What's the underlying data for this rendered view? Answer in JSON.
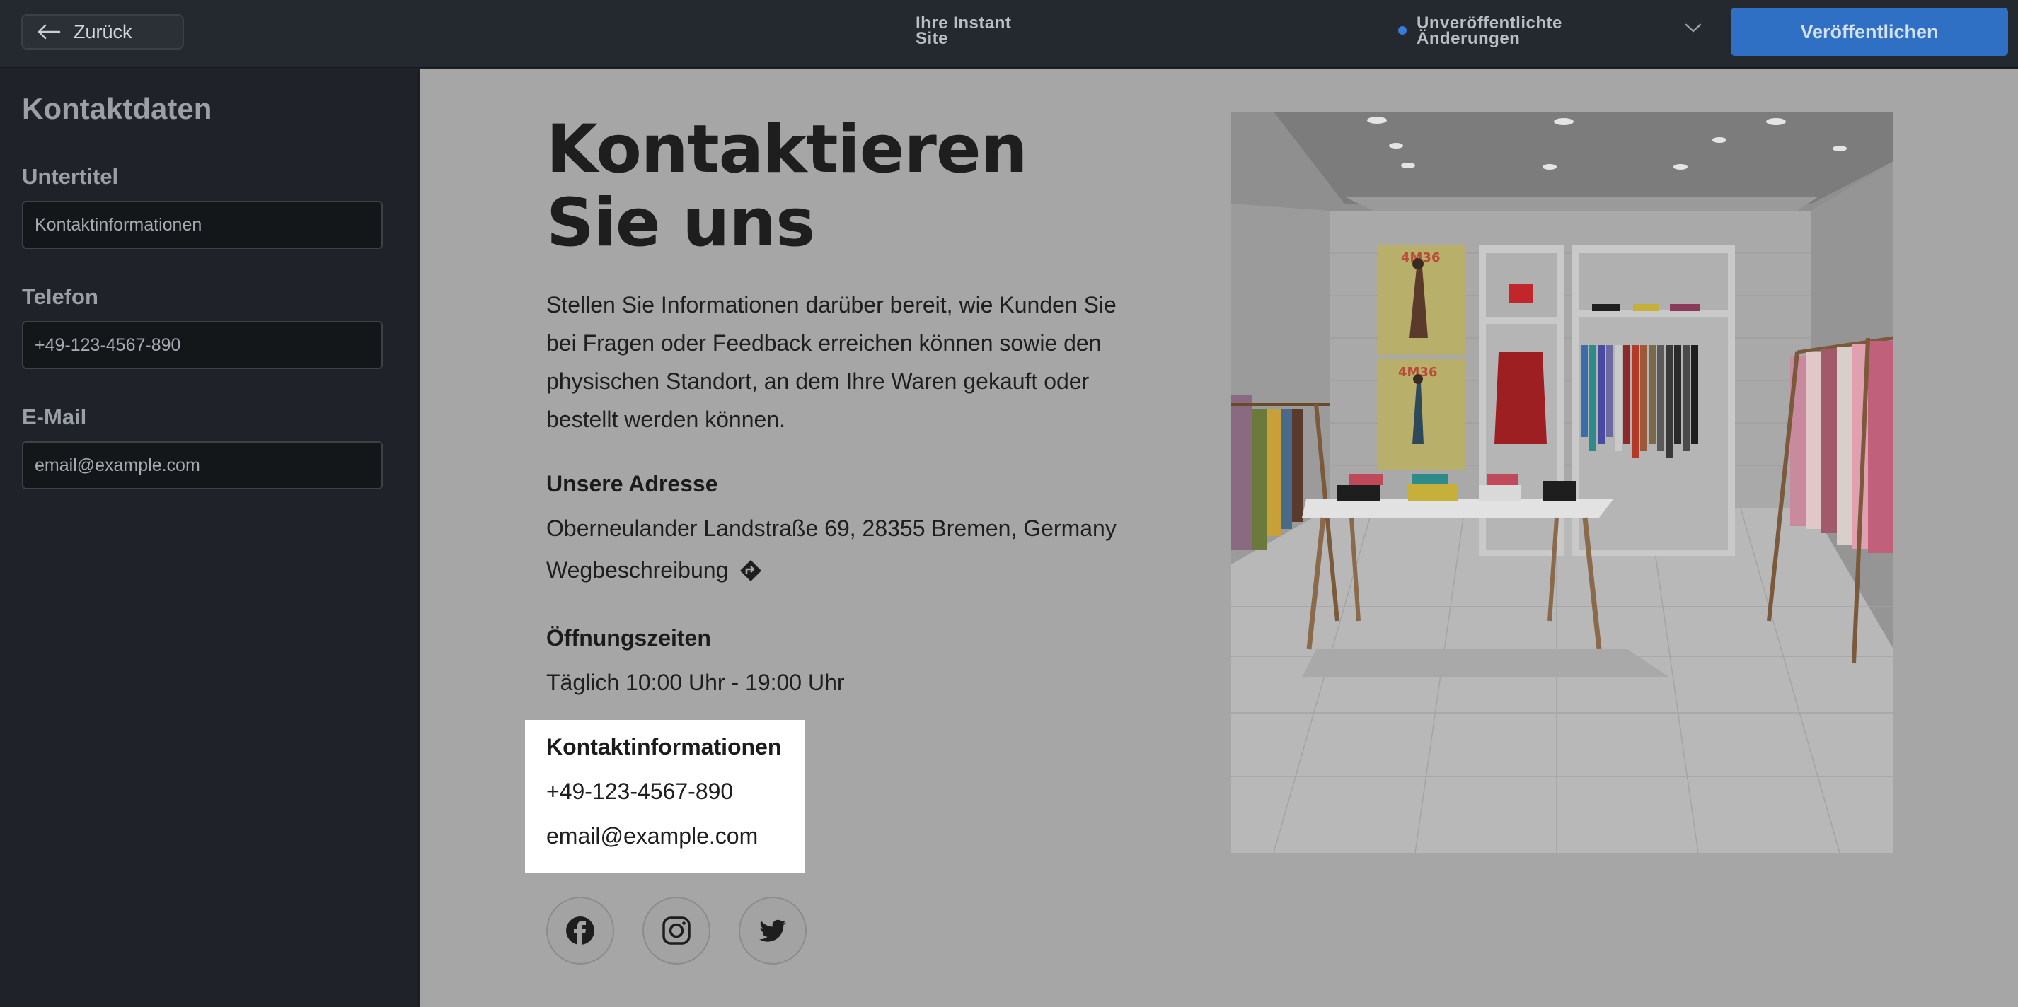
{
  "topbar": {
    "back_label": "Zurück",
    "site_title": "Ihre Instant Site",
    "status_text": "Unveröffentlichte Änderungen",
    "publish_label": "Veröffentlichen"
  },
  "sidebar": {
    "title": "Kontaktdaten",
    "fields": [
      {
        "label": "Untertitel",
        "value": "Kontaktinformationen"
      },
      {
        "label": "Telefon",
        "value": "+49-123-4567-890"
      },
      {
        "label": "E-Mail",
        "value": "email@example.com"
      }
    ]
  },
  "page": {
    "heading": "Kontaktieren Sie uns",
    "description": "Stellen Sie Informationen darüber bereit, wie Kunden Sie bei Fragen oder Feedback erreichen können sowie den physischen Standort, an dem Ihre Waren gekauft oder bestellt werden können.",
    "address_label": "Unsere Adresse",
    "address": "Oberneulander Landstraße 69, 28355 Bremen, Germany",
    "directions_label": "Wegbeschreibung",
    "hours_label": "Öffnungszeiten",
    "hours": "Täglich 10:00 Uhr - 19:00 Uhr",
    "contact": {
      "title": "Kontaktinformationen",
      "phone": "+49-123-4567-890",
      "email": "email@example.com"
    },
    "poster_text": [
      "4M36",
      "4M36"
    ],
    "social_icons": [
      "facebook-icon",
      "instagram-icon",
      "twitter-icon"
    ]
  },
  "colors": {
    "accent": "#2f6fc4",
    "status_dot": "#3b7bd5",
    "canvas_bg": "#a6a6a6",
    "panel_bg": "#1f2329"
  }
}
